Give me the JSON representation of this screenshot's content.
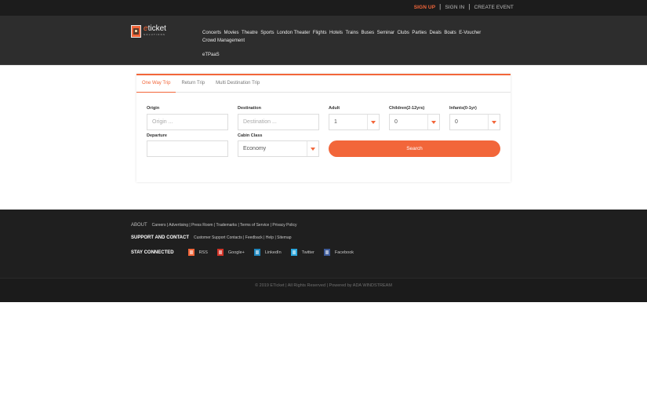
{
  "topbar": {
    "signup": "SIGN UP",
    "signin": "SIGN IN",
    "create_event": "CREATE EVENT",
    "separator": "|"
  },
  "brand": {
    "name_prefix": "e",
    "name_rest": "ticket",
    "tagline": "SOLUTIONS",
    "accent": "#f2663a"
  },
  "nav": {
    "items": [
      "Concerts",
      "Movies",
      "Theatre",
      "Sports",
      "London Theater",
      "Flights",
      "Hotels",
      "Trains",
      "Buses",
      "Seminar",
      "Clubs",
      "Parties",
      "Deals",
      "Boats",
      "E-Voucher",
      "Crowd Management",
      "eTPaaS"
    ]
  },
  "search": {
    "tabs": [
      "One Way Trip",
      "Return Trip",
      "Multi Destination Trip"
    ],
    "active_tab": "One Way Trip",
    "origin_label": "Origin",
    "origin_placeholder": "Origin ...",
    "destination_label": "Destination",
    "destination_placeholder": "Destination ...",
    "adult_label": "Adult",
    "adult_value": "1",
    "children_label": "Children(2-12yrs)",
    "children_value": "0",
    "infants_label": "Infants(0-1yr)",
    "infants_value": "0",
    "departure_label": "Departure",
    "cabin_label": "Cabin Class",
    "cabin_value": "Economy",
    "search_label": "Search"
  },
  "footer": {
    "about_heading": "ABOUT",
    "about_links": "Careers | Advertising | Press Room | Trademarks | Terms of Service | Privacy Policy",
    "support_heading": "SUPPORT AND CONTACT",
    "support_links": "Customer Support Contacts | Feedback | Help | Sitemap",
    "social_heading": "STAY CONNECTED",
    "social": [
      {
        "label": "RSS",
        "icon": "rss-icon",
        "color": "#f2663a"
      },
      {
        "label": "Google+",
        "icon": "google-plus-icon",
        "color": "#d23428"
      },
      {
        "label": "LinkedIn",
        "icon": "linkedin-icon",
        "color": "#1f86bd"
      },
      {
        "label": "Twitter",
        "icon": "twitter-icon",
        "color": "#2ba6dc"
      },
      {
        "label": "Facebook",
        "icon": "facebook-icon",
        "color": "#3d5a98"
      }
    ],
    "copyright": "© 2019 ETicket | All Rights Reserved | Powered by ADA WINDSTREAM"
  }
}
